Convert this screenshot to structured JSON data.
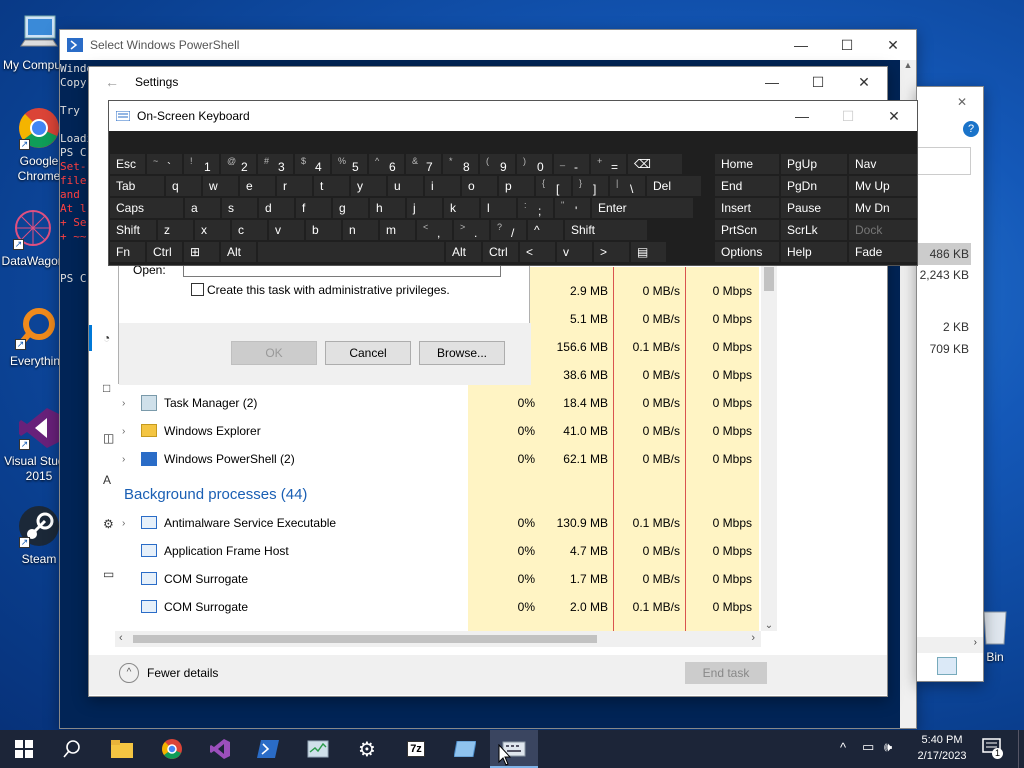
{
  "desktop": {
    "icons": [
      {
        "label": "My Computer",
        "label_line2": ""
      },
      {
        "label": "Google",
        "label_line2": "Chrome"
      },
      {
        "label": "DataWagon",
        "label_line2": ""
      },
      {
        "label": "Everythin",
        "label_line2": ""
      },
      {
        "label": "Visual Studio",
        "label_line2": "2015"
      },
      {
        "label": "Steam",
        "label_line2": ""
      }
    ],
    "recycle_bin_label": "e Bin"
  },
  "powershell": {
    "title": "Select Windows PowerShell",
    "lines": [
      {
        "text": "Windo",
        "red": false
      },
      {
        "text": "Copyr",
        "red": false
      },
      {
        "text": "",
        "red": false
      },
      {
        "text": "Try ",
        "red": false
      },
      {
        "text": "",
        "red": false
      },
      {
        "text": "Loadi",
        "red": false
      },
      {
        "text": "PS C",
        "red": false
      },
      {
        "text": "Set-",
        "red": true
      },
      {
        "text": "file",
        "red": true
      },
      {
        "text": "and ",
        "red": true
      },
      {
        "text": "At l",
        "red": true
      },
      {
        "text": "+ Se",
        "red": true
      },
      {
        "text": "+ ~~",
        "red": true
      },
      {
        "text": "",
        "red": false
      },
      {
        "text": "",
        "red": false
      },
      {
        "text": "PS C",
        "red": false
      }
    ]
  },
  "settings": {
    "title": "Settings"
  },
  "explorer_right": {
    "sizes": [
      "486 KB",
      "2,243 KB",
      "2 KB",
      "709 KB"
    ]
  },
  "osk": {
    "title": "On-Screen Keyboard",
    "rows": [
      [
        "Esc",
        "~ `",
        "! 1",
        "@ 2",
        "# 3",
        "$ 4",
        "% 5",
        "^ 6",
        "& 7",
        "* 8",
        "( 9",
        ") 0",
        "_ -",
        "+ =",
        "⌫"
      ],
      [
        "Tab",
        "q",
        "w",
        "e",
        "r",
        "t",
        "y",
        "u",
        "i",
        "o",
        "p",
        "{ [",
        "} ]",
        "| \\",
        "Del"
      ],
      [
        "Caps",
        "a",
        "s",
        "d",
        "f",
        "g",
        "h",
        "j",
        "k",
        "l",
        ": ;",
        "\" '",
        "Enter"
      ],
      [
        "Shift",
        "z",
        "x",
        "c",
        "v",
        "b",
        "n",
        "m",
        "< ,",
        "> .",
        "? /",
        "^",
        "Shift"
      ],
      [
        "Fn",
        "Ctrl",
        "⊞",
        "Alt",
        "",
        "Alt",
        "Ctrl",
        "<",
        "v",
        ">",
        "▤"
      ]
    ],
    "side_keys": [
      [
        "Home",
        "PgUp",
        "Nav"
      ],
      [
        "End",
        "PgDn",
        "Mv Up"
      ],
      [
        "Insert",
        "Pause",
        "Mv Dn"
      ],
      [
        "PrtScn",
        "ScrLk",
        "Dock"
      ],
      [
        "Options",
        "Help",
        "Fade"
      ]
    ]
  },
  "run_dialog": {
    "open_label": "Open:",
    "checkbox_label": "Create this task with administrative privileges.",
    "ok": "OK",
    "cancel": "Cancel",
    "browse": "Browse..."
  },
  "task_manager": {
    "partial_rows": [
      {
        "cpu": "",
        "mem": "2.9 MB",
        "disk": "0 MB/s",
        "net": "0 Mbps"
      },
      {
        "cpu": "",
        "mem": "5.1 MB",
        "disk": "0 MB/s",
        "net": "0 Mbps"
      },
      {
        "cpu": "",
        "mem": "156.6 MB",
        "disk": "0.1 MB/s",
        "net": "0 Mbps"
      },
      {
        "cpu": "",
        "mem": "38.6 MB",
        "disk": "0 MB/s",
        "net": "0 Mbps"
      }
    ],
    "apps": [
      {
        "name": "Task Manager (2)",
        "cpu": "0%",
        "mem": "18.4 MB",
        "disk": "0 MB/s",
        "net": "0 Mbps"
      },
      {
        "name": "Windows Explorer",
        "cpu": "0%",
        "mem": "41.0 MB",
        "disk": "0 MB/s",
        "net": "0 Mbps"
      },
      {
        "name": "Windows PowerShell (2)",
        "cpu": "0%",
        "mem": "62.1 MB",
        "disk": "0 MB/s",
        "net": "0 Mbps"
      }
    ],
    "bg_header": "Background processes (44)",
    "bg": [
      {
        "name": "Antimalware Service Executable",
        "cpu": "0%",
        "mem": "130.9 MB",
        "disk": "0.1 MB/s",
        "net": "0 Mbps"
      },
      {
        "name": "Application Frame Host",
        "cpu": "0%",
        "mem": "4.7 MB",
        "disk": "0 MB/s",
        "net": "0 Mbps"
      },
      {
        "name": "COM Surrogate",
        "cpu": "0%",
        "mem": "1.7 MB",
        "disk": "0 MB/s",
        "net": "0 Mbps"
      },
      {
        "name": "COM Surrogate",
        "cpu": "0%",
        "mem": "2.0 MB",
        "disk": "0.1 MB/s",
        "net": "0 Mbps"
      }
    ],
    "fewer_details": "Fewer details",
    "end_task": "End task"
  },
  "taskbar": {
    "time": "5:40 PM",
    "date": "2/17/2023",
    "notification_count": "1"
  }
}
